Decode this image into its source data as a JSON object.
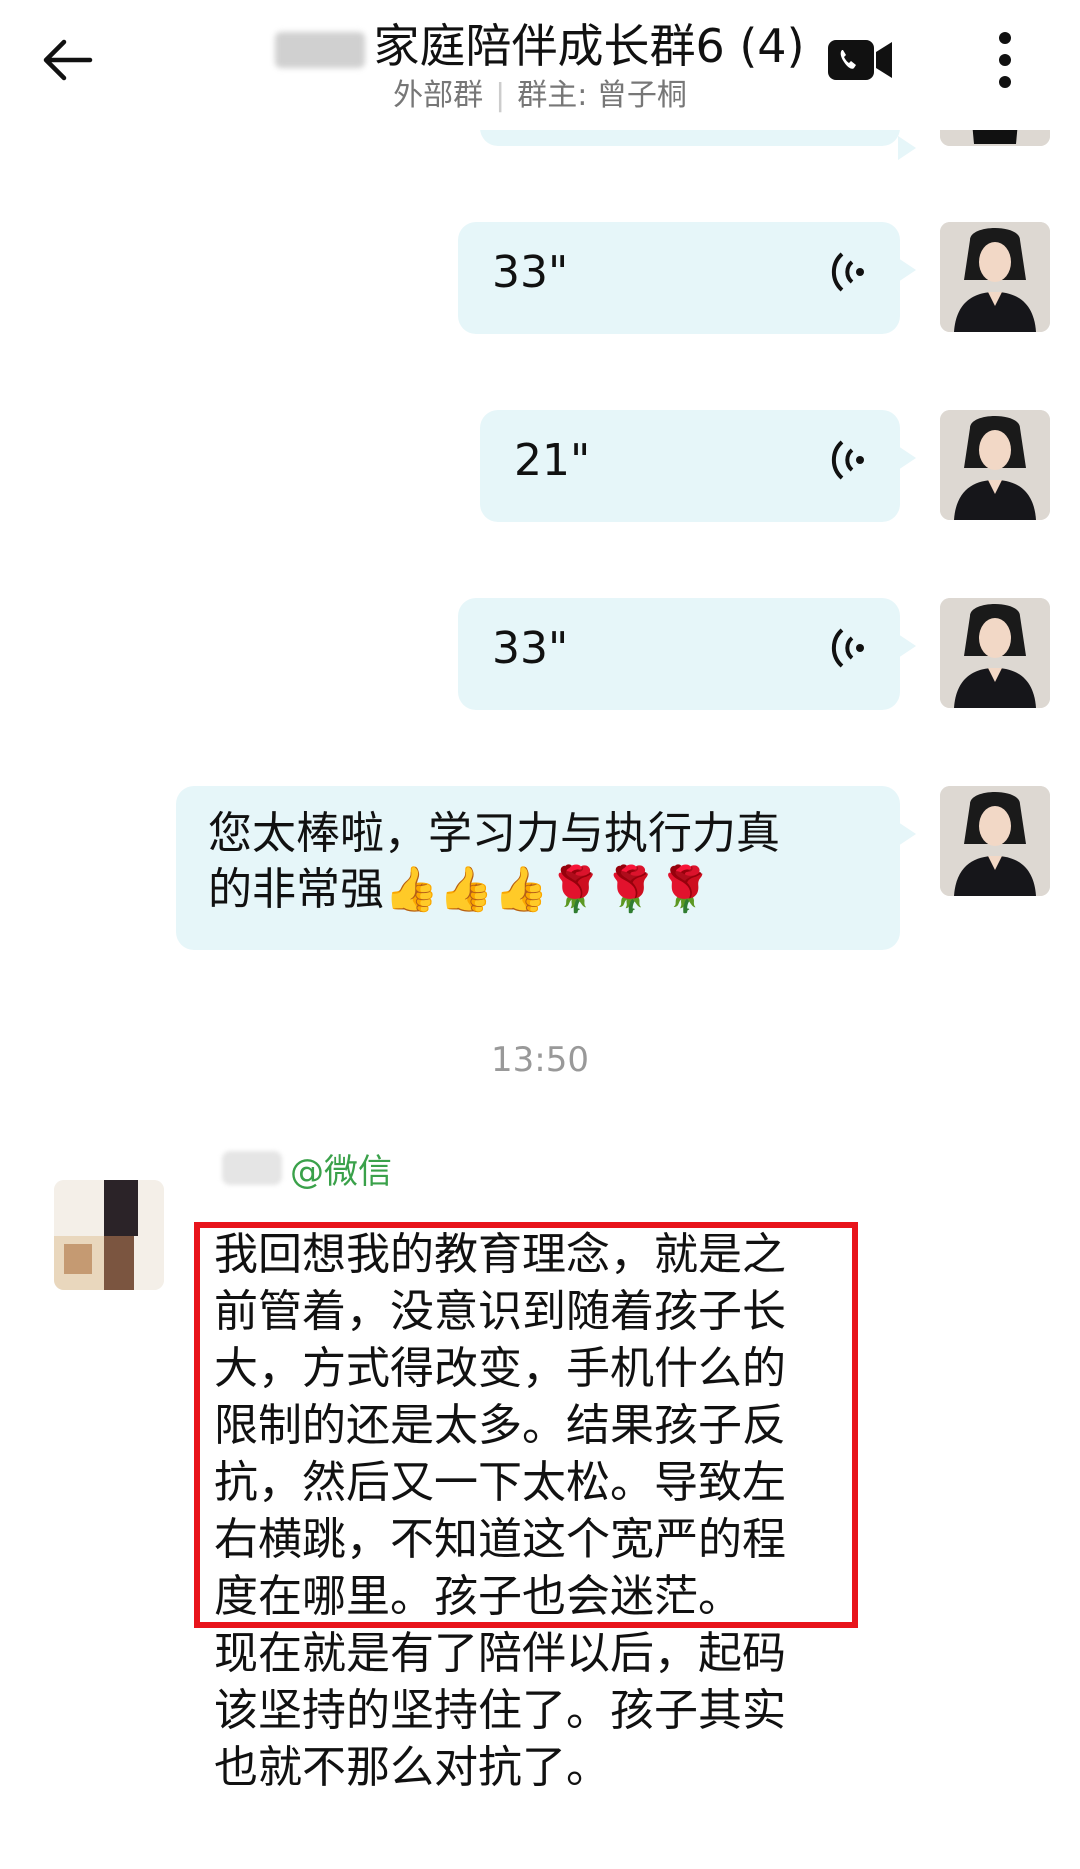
{
  "header": {
    "title": "家庭陪伴成长群6 (4)",
    "subtitle_left": "外部群",
    "subtitle_right": "群主: 曾子桐",
    "icons": {
      "back": "arrow-left-icon",
      "video": "video-call-icon",
      "more": "more-vert-icon"
    }
  },
  "messages": {
    "voice1": {
      "duration": "33\""
    },
    "voice2": {
      "duration": "21\""
    },
    "voice3": {
      "duration": "33\""
    },
    "text1": {
      "line1": "您太棒啦，学习力与执行力真",
      "line2": "的非常强",
      "emoji": "👍👍👍🌹🌹🌹"
    }
  },
  "timestamp": "13:50",
  "incoming": {
    "sender_suffix": "@微信",
    "highlighted_lines": [
      "我回想我的教育理念，就是之",
      "前管着，没意识到随着孩子长",
      "大，方式得改变，手机什么的",
      "限制的还是太多。结果孩子反",
      "抗，然后又一下太松。导致左",
      "右横跳，不知道这个宽严的程",
      "度在哪里。孩子也会迷茫。"
    ],
    "rest_lines": [
      "现在就是有了陪伴以后，起码",
      "该坚持的坚持住了。孩子其实",
      "也就不那么对抗了。"
    ]
  },
  "colors": {
    "bubble": "#e6f6f9",
    "highlight": "#e8141b",
    "sender": "#3aa14a"
  }
}
